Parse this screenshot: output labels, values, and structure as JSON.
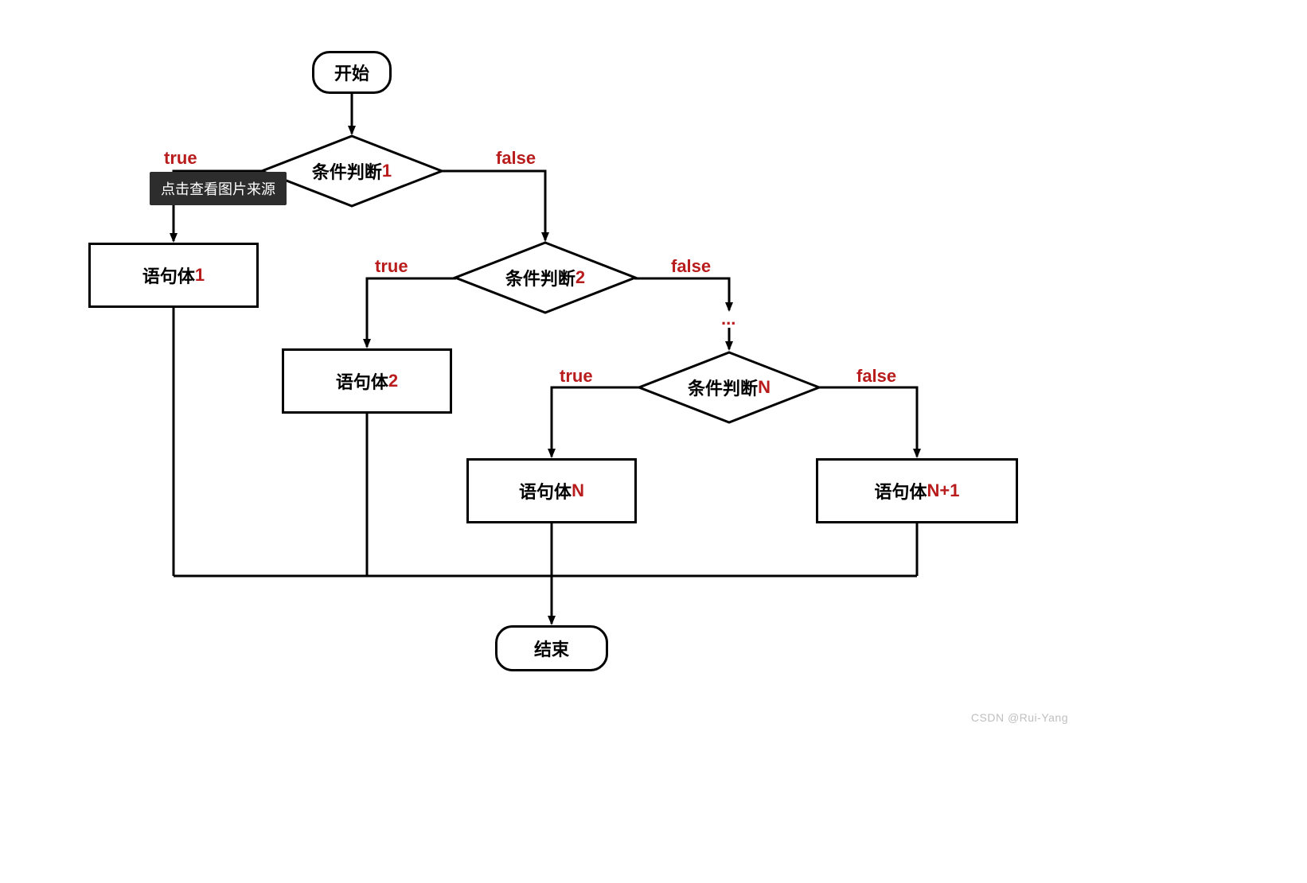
{
  "nodes": {
    "start": "开始",
    "cond1_prefix": "条件判断 ",
    "cond1_num": "1",
    "stmt1_prefix": "语句体 ",
    "stmt1_num": "1",
    "cond2_prefix": "条件判断",
    "cond2_num": "2",
    "stmt2_prefix": "语句体 ",
    "stmt2_num": "2",
    "condN_prefix": "条件判断",
    "condN_num": "N",
    "stmtN_prefix": "语句体 ",
    "stmtN_num": "N",
    "stmtN1_prefix": "语句体 ",
    "stmtN1_num": "N+1",
    "end": "结束"
  },
  "labels": {
    "true": "true",
    "false": "false",
    "dots": "..."
  },
  "tooltip": "点击查看图片来源",
  "watermark": "CSDN @Rui-Yang"
}
